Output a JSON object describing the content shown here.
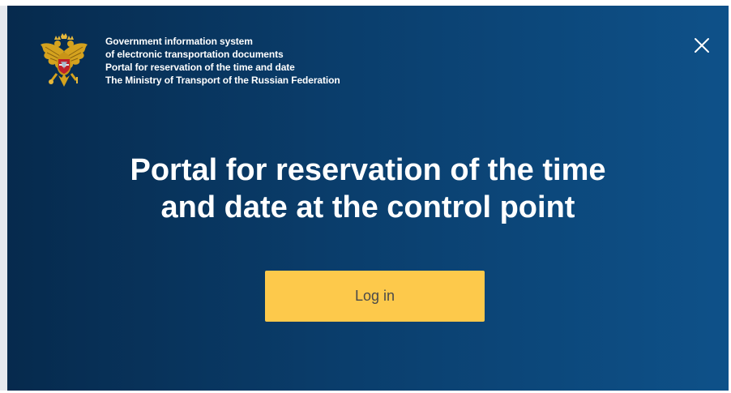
{
  "header": {
    "emblem_icon": "russian-coat-of-arms-icon",
    "org_lines": [
      "Government information system",
      "of electronic transportation documents",
      "Portal for reservation of the time and date",
      "The Ministry of Transport of the Russian Federation"
    ],
    "close_icon": "close-icon"
  },
  "main": {
    "title_line1": "Portal for reservation of the time",
    "title_line2": "and date at the control point",
    "login_label": "Log in"
  },
  "colors": {
    "background_dark": "#062a4d",
    "background_light": "#0e5189",
    "button": "#fdc94b",
    "button_text": "#4a4a4a",
    "text": "#ffffff"
  }
}
